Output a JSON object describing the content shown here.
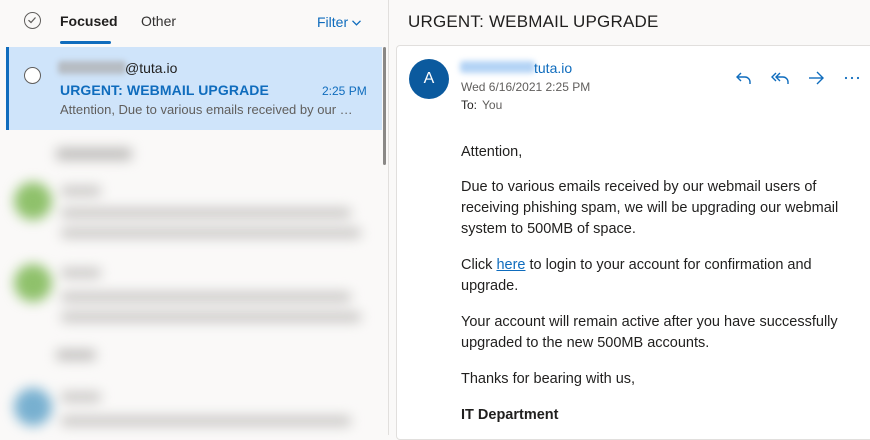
{
  "list": {
    "tabs": [
      {
        "label": "Focused"
      },
      {
        "label": "Other"
      }
    ],
    "filter_label": "Filter",
    "selected_message": {
      "sender": "@tuta.io",
      "subject": "URGENT: WEBMAIL UPGRADE",
      "time": "2:25 PM",
      "preview": "Attention, Due to various emails received by our webmail users of receiving phishing spam"
    }
  },
  "reading_pane": {
    "title": "URGENT: WEBMAIL UPGRADE",
    "avatar_initial": "A",
    "from_domain": "tuta.io",
    "date": "Wed 6/16/2021 2:25 PM",
    "to_label": "To:",
    "to_value": "You",
    "body": {
      "greeting": "Attention,",
      "p1": "Due to various emails received by our webmail users of receiving phishing spam, we will be upgrading our webmail system to 500MB of space.",
      "p2_before": "Click ",
      "p2_link": "here",
      "p2_after": " to login to your account for confirmation and upgrade.",
      "p3": "Your account will remain active after you have successfully upgraded to the new 500MB accounts.",
      "p4": "Thanks for bearing with us,",
      "signature": "IT Department"
    }
  },
  "actions": [
    "reply-icon",
    "reply-all-icon",
    "forward-icon",
    "more-icon"
  ],
  "colors": {
    "accent": "#0f6cbd",
    "selected_bg": "#cfe4fa",
    "avatar_bg": "#0b5a9e"
  }
}
